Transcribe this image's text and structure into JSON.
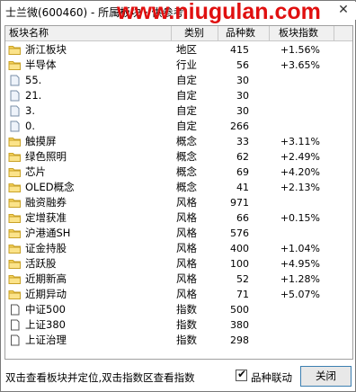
{
  "window": {
    "title": "士兰微(600460) - 所属板块 · 供参考",
    "watermark": "www.niugulan.com",
    "close_glyph": "✕"
  },
  "columns": {
    "name": "板块名称",
    "type": "类别",
    "count": "品种数",
    "index": "板块指数"
  },
  "rows": [
    {
      "icon": "folder",
      "name": "浙江板块",
      "type": "地区",
      "count": "415",
      "index": "+1.56%"
    },
    {
      "icon": "folder",
      "name": "半导体",
      "type": "行业",
      "count": "56",
      "index": "+3.65%"
    },
    {
      "icon": "page",
      "name": "55.",
      "type": "自定",
      "count": "30",
      "index": ""
    },
    {
      "icon": "page",
      "name": "21.",
      "type": "自定",
      "count": "30",
      "index": ""
    },
    {
      "icon": "page",
      "name": "3.",
      "type": "自定",
      "count": "30",
      "index": ""
    },
    {
      "icon": "page",
      "name": "0.",
      "type": "自定",
      "count": "266",
      "index": ""
    },
    {
      "icon": "folder",
      "name": "触摸屏",
      "type": "概念",
      "count": "33",
      "index": "+3.11%"
    },
    {
      "icon": "folder",
      "name": "绿色照明",
      "type": "概念",
      "count": "62",
      "index": "+2.49%"
    },
    {
      "icon": "folder",
      "name": "芯片",
      "type": "概念",
      "count": "69",
      "index": "+4.20%"
    },
    {
      "icon": "folder",
      "name": "OLED概念",
      "type": "概念",
      "count": "41",
      "index": "+2.13%"
    },
    {
      "icon": "folder",
      "name": "融资融券",
      "type": "风格",
      "count": "971",
      "index": ""
    },
    {
      "icon": "folder",
      "name": "定增获准",
      "type": "风格",
      "count": "66",
      "index": "+0.15%"
    },
    {
      "icon": "folder",
      "name": "沪港通SH",
      "type": "风格",
      "count": "576",
      "index": ""
    },
    {
      "icon": "folder",
      "name": "证金持股",
      "type": "风格",
      "count": "400",
      "index": "+1.04%"
    },
    {
      "icon": "folder",
      "name": "活跃股",
      "type": "风格",
      "count": "100",
      "index": "+4.95%"
    },
    {
      "icon": "folder",
      "name": "近期新高",
      "type": "风格",
      "count": "52",
      "index": "+1.28%"
    },
    {
      "icon": "folder",
      "name": "近期异动",
      "type": "风格",
      "count": "71",
      "index": "+5.07%"
    },
    {
      "icon": "doc",
      "name": "中证500",
      "type": "指数",
      "count": "500",
      "index": ""
    },
    {
      "icon": "doc",
      "name": "上证380",
      "type": "指数",
      "count": "380",
      "index": ""
    },
    {
      "icon": "doc",
      "name": "上证治理",
      "type": "指数",
      "count": "298",
      "index": ""
    }
  ],
  "footer": {
    "hint": "双击查看板块并定位,双击指数区查看指数",
    "checkbox_label": "品种联动",
    "checkbox_checked": true,
    "close_button": "关闭"
  },
  "colors": {
    "folder_fill": "#f7d35b",
    "folder_stroke": "#c9a227",
    "watermark": "#e01010",
    "button_border": "#3c7fb1"
  }
}
